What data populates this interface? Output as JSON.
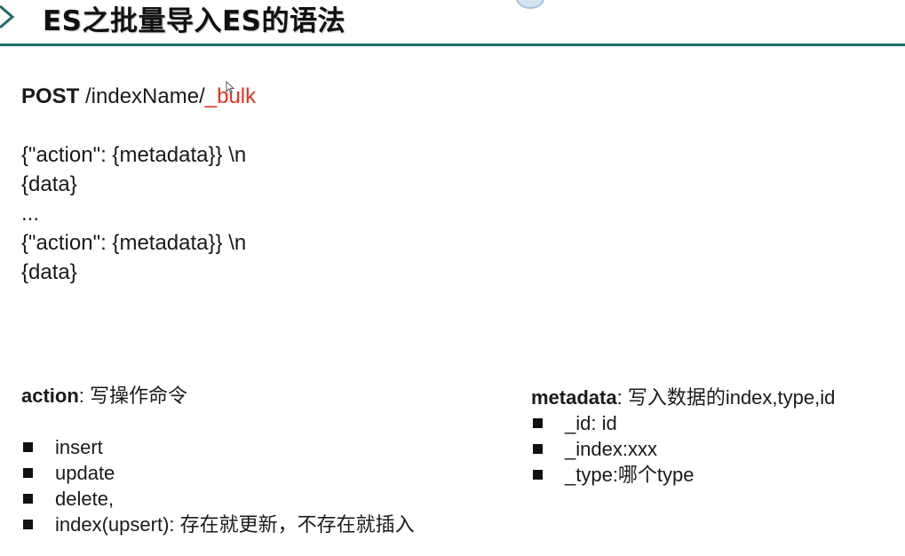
{
  "slide": {
    "title": "ES之批量导入ES的语法"
  },
  "request": {
    "method": "POST",
    "path": "/indexName/",
    "endpoint": "_bulk"
  },
  "body_lines": [
    "{\"action\": {metadata}} \\n",
    "{data}",
    "...",
    "{\"action\": {metadata}} \\n",
    "{data}"
  ],
  "action_section": {
    "label": "action",
    "description": ": 写操作命令",
    "items": [
      "insert",
      "update",
      "delete,",
      "index(upsert): 存在就更新，不存在就插入"
    ]
  },
  "metadata_section": {
    "label": "metadata",
    "description": ": 写入数据的index,type,id",
    "items": [
      "_id: id",
      "_index:xxx",
      "_type:哪个type"
    ]
  },
  "colors": {
    "title_rule": "#1e6b68",
    "chevron": "#1e6b68",
    "endpoint_highlight": "#e8311a",
    "text": "#1a1a1a"
  },
  "icons": {
    "title_marker": "chevron-right-icon",
    "list_bullet": "square-bullet-icon",
    "mouse_cursor": "mouse-pointer-icon"
  }
}
